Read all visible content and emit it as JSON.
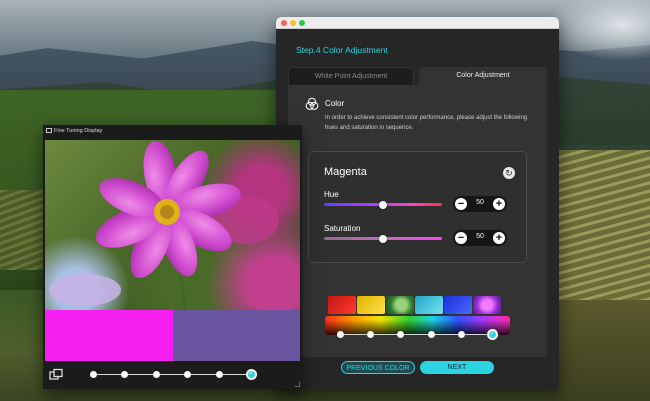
{
  "main_window": {
    "step_title": "Step.4 Color Adjustment",
    "tabs": [
      {
        "label": "White Point Adjustment",
        "active": false
      },
      {
        "label": "Color Adjustment",
        "active": true
      }
    ],
    "section": {
      "heading": "Color",
      "description": "In order to achieve consistent color performance, please adjust the following hues and saturation in sequence."
    },
    "adjustment": {
      "color_name": "Magenta",
      "hue": {
        "label": "Hue",
        "value": "50",
        "fraction": 0.5
      },
      "saturation": {
        "label": "Saturation",
        "value": "50",
        "fraction": 0.5
      }
    },
    "progress": {
      "total": 6,
      "current": 6
    },
    "buttons": {
      "previous": "PREVIOUS COLOR",
      "next": "NEXT"
    }
  },
  "fine_window": {
    "title": "Fine Tuning Display",
    "swatch_left_color": "#f51ff0",
    "swatch_right_color": "#6a55a1",
    "progress": {
      "total": 6,
      "current": 6
    }
  },
  "colors": {
    "accent": "#2cd3e1",
    "window_bg": "#262626",
    "panel_bg": "#333333"
  }
}
